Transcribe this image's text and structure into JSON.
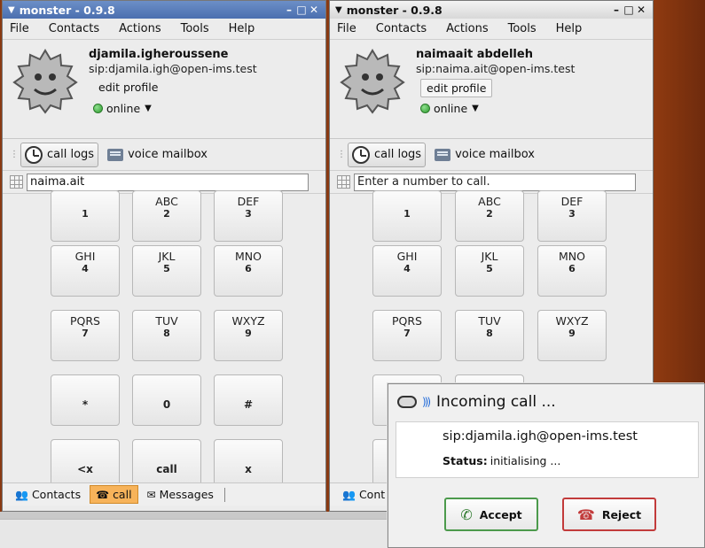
{
  "windows": [
    {
      "title": "monster - 0.9.8",
      "menu": [
        "File",
        "Contacts",
        "Actions",
        "Tools",
        "Help"
      ],
      "profile": {
        "name": "djamila.igheroussene",
        "uri": "sip:djamila.igh@open-ims.test",
        "edit_label": "edit profile",
        "presence": "online"
      },
      "toolbar": {
        "call_logs": "call logs",
        "voice_mailbox": "voice mailbox"
      },
      "number_input": {
        "value": "naima.ait",
        "placeholder": ""
      },
      "keys": [
        {
          "letters": "",
          "digit": "1"
        },
        {
          "letters": "ABC",
          "digit": "2"
        },
        {
          "letters": "DEF",
          "digit": "3"
        },
        {
          "letters": "GHI",
          "digit": "4"
        },
        {
          "letters": "JKL",
          "digit": "5"
        },
        {
          "letters": "MNO",
          "digit": "6"
        },
        {
          "letters": "PQRS",
          "digit": "7"
        },
        {
          "letters": "TUV",
          "digit": "8"
        },
        {
          "letters": "WXYZ",
          "digit": "9"
        },
        {
          "letters": "",
          "digit": "*"
        },
        {
          "letters": "",
          "digit": "0"
        },
        {
          "letters": "",
          "digit": "#"
        },
        {
          "letters": "",
          "digit": "<x"
        },
        {
          "letters": "",
          "digit": "call"
        },
        {
          "letters": "",
          "digit": "x"
        }
      ],
      "tabs": [
        {
          "label": "Contacts"
        },
        {
          "label": "call"
        },
        {
          "label": "Messages"
        }
      ]
    },
    {
      "title": "monster - 0.9.8",
      "menu": [
        "File",
        "Contacts",
        "Actions",
        "Tools",
        "Help"
      ],
      "profile": {
        "name": "naimaait abdelleh",
        "uri": "sip:naima.ait@open-ims.test",
        "edit_label": "edit profile",
        "presence": "online"
      },
      "toolbar": {
        "call_logs": "call logs",
        "voice_mailbox": "voice mailbox"
      },
      "number_input": {
        "value": "",
        "placeholder": "Enter a number to call."
      },
      "keys": [
        {
          "letters": "",
          "digit": "1"
        },
        {
          "letters": "ABC",
          "digit": "2"
        },
        {
          "letters": "DEF",
          "digit": "3"
        },
        {
          "letters": "GHI",
          "digit": "4"
        },
        {
          "letters": "JKL",
          "digit": "5"
        },
        {
          "letters": "MNO",
          "digit": "6"
        },
        {
          "letters": "PQRS",
          "digit": "7"
        },
        {
          "letters": "TUV",
          "digit": "8"
        },
        {
          "letters": "WXYZ",
          "digit": "9"
        }
      ],
      "tabs": [
        {
          "label": "Cont"
        }
      ]
    }
  ],
  "incoming_call": {
    "title": "Incoming call ...",
    "caller": "sip:djamila.igh@open-ims.test",
    "status_label": "Status:",
    "status_value": "initialising ...",
    "accept_label": "Accept",
    "reject_label": "Reject"
  },
  "colors": {
    "active_tab": "#f7b35a",
    "accept_border": "#4c9a4c",
    "reject_border": "#c23b3b",
    "desktop": "#8a3a12"
  },
  "icons": [
    "gear-avatar-icon",
    "online-dot-icon",
    "clock-icon",
    "voicemail-icon",
    "numpad-icon",
    "contacts-icon",
    "phone-icon",
    "messages-icon",
    "phone-wave-icon",
    "accept-phone-icon",
    "reject-phone-icon"
  ]
}
